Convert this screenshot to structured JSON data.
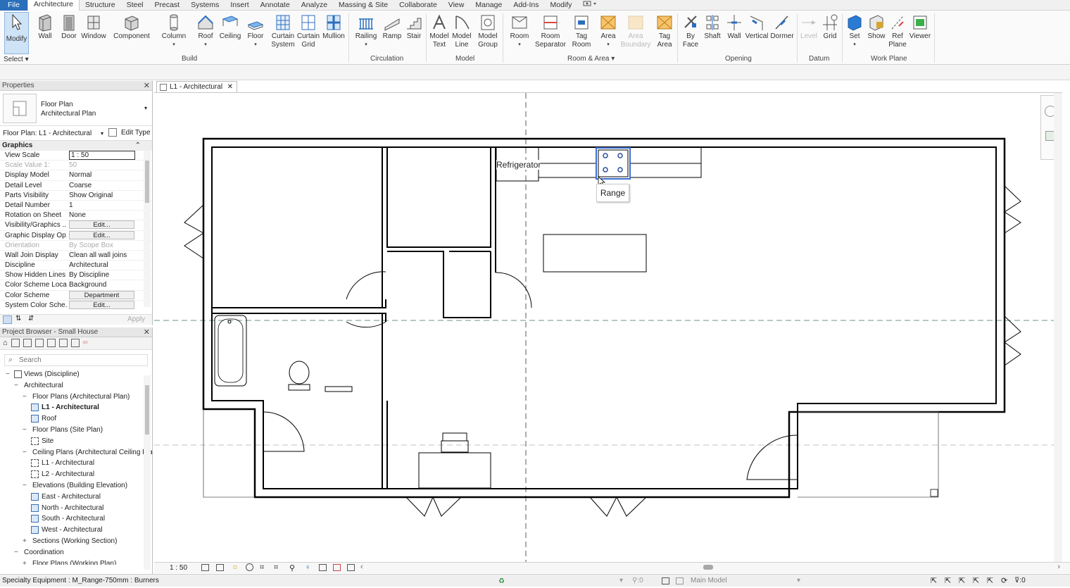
{
  "menu": {
    "file": "File",
    "tabs": [
      "Architecture",
      "Structure",
      "Steel",
      "Precast",
      "Systems",
      "Insert",
      "Annotate",
      "Analyze",
      "Massing & Site",
      "Collaborate",
      "View",
      "Manage",
      "Add-Ins",
      "Modify"
    ],
    "active": "Architecture"
  },
  "ribbon": {
    "modify": "Modify",
    "select": "Select",
    "groups": {
      "build": "Build",
      "circulation": "Circulation",
      "model": "Model",
      "room_area": "Room & Area",
      "opening": "Opening",
      "datum": "Datum",
      "work_plane": "Work Plane"
    },
    "tools": {
      "wall": "Wall",
      "door": "Door",
      "window": "Window",
      "component": "Component",
      "column": "Column",
      "roof": "Roof",
      "ceiling": "Ceiling",
      "floor": "Floor",
      "curtain_system_1": "Curtain",
      "curtain_system_2": "System",
      "curtain_grid_1": "Curtain",
      "curtain_grid_2": "Grid",
      "mullion": "Mullion",
      "railing": "Railing",
      "ramp": "Ramp",
      "stair": "Stair",
      "model_text_1": "Model",
      "model_text_2": "Text",
      "model_line_1": "Model",
      "model_line_2": "Line",
      "model_group_1": "Model",
      "model_group_2": "Group",
      "room": "Room",
      "room_sep_1": "Room",
      "room_sep_2": "Separator",
      "tag_room_1": "Tag",
      "tag_room_2": "Room",
      "area": "Area",
      "area_boundary_1": "Area",
      "area_boundary_2": "Boundary",
      "tag_area_1": "Tag",
      "tag_area_2": "Area",
      "by_face_1": "By",
      "by_face_2": "Face",
      "shaft": "Shaft",
      "wall_open": "Wall",
      "vertical": "Vertical",
      "dormer": "Dormer",
      "level": "Level",
      "grid": "Grid",
      "set": "Set",
      "show": "Show",
      "ref_plane_1": "Ref",
      "ref_plane_2": "Plane",
      "viewer": "Viewer"
    }
  },
  "properties": {
    "title": "Properties",
    "type_line1": "Floor Plan",
    "type_line2": "Architectural Plan",
    "instance": "Floor Plan: L1 - Architectural",
    "edit_type": "Edit Type",
    "section": "Graphics",
    "rows": [
      {
        "k": "View Scale",
        "v": "1 : 50"
      },
      {
        "k": "Scale Value    1:",
        "v": "50"
      },
      {
        "k": "Display Model",
        "v": "Normal"
      },
      {
        "k": "Detail Level",
        "v": "Coarse"
      },
      {
        "k": "Parts Visibility",
        "v": "Show Original"
      },
      {
        "k": "Detail Number",
        "v": "1"
      },
      {
        "k": "Rotation on Sheet",
        "v": "None"
      },
      {
        "k": "Visibility/Graphics ...",
        "v": "Edit..."
      },
      {
        "k": "Graphic Display Op...",
        "v": "Edit..."
      },
      {
        "k": "Orientation",
        "v": "By Scope Box"
      },
      {
        "k": "Wall Join Display",
        "v": "Clean all wall joins"
      },
      {
        "k": "Discipline",
        "v": "Architectural"
      },
      {
        "k": "Show Hidden Lines",
        "v": "By Discipline"
      },
      {
        "k": "Color Scheme Loca...",
        "v": "Background"
      },
      {
        "k": "Color Scheme",
        "v": "Department"
      },
      {
        "k": "System Color Sche...",
        "v": "Edit..."
      }
    ],
    "apply": "Apply"
  },
  "browser": {
    "title": "Project Browser - Small House",
    "search_placeholder": "Search",
    "items": [
      {
        "label": "Views (Discipline)",
        "depth": 0,
        "toggle": "−"
      },
      {
        "label": "Architectural",
        "depth": 1,
        "toggle": "−"
      },
      {
        "label": "Floor Plans (Architectural Plan)",
        "depth": 2,
        "toggle": "−"
      },
      {
        "label": "L1 - Architectural",
        "depth": 3,
        "bold": true
      },
      {
        "label": "Roof",
        "depth": 3
      },
      {
        "label": "Floor Plans (Site Plan)",
        "depth": 2,
        "toggle": "−"
      },
      {
        "label": "Site",
        "depth": 3,
        "plain": true
      },
      {
        "label": "Ceiling Plans (Architectural Ceiling Pla",
        "depth": 2,
        "toggle": "−"
      },
      {
        "label": "L1 - Architectural",
        "depth": 3,
        "plain": true
      },
      {
        "label": "L2 - Architectural",
        "depth": 3,
        "plain": true
      },
      {
        "label": "Elevations (Building Elevation)",
        "depth": 2,
        "toggle": "−"
      },
      {
        "label": "East - Architectural",
        "depth": 3
      },
      {
        "label": "North - Architectural",
        "depth": 3
      },
      {
        "label": "South - Architectural",
        "depth": 3
      },
      {
        "label": "West - Architectural",
        "depth": 3
      },
      {
        "label": "Sections (Working Section)",
        "depth": 2,
        "toggle": "+"
      },
      {
        "label": "Coordination",
        "depth": 1,
        "toggle": "−"
      },
      {
        "label": "Floor Plans (Working Plan)",
        "depth": 2,
        "toggle": "+"
      }
    ]
  },
  "view_tab": {
    "label": "L1 - Architectural"
  },
  "plan": {
    "refrigerator": "Refrigerator",
    "range": "Range"
  },
  "view_bar": {
    "scale": "1 : 50"
  },
  "status": {
    "text": "Specialty Equipment : M_Range-750mm : Burners",
    "model": "Main Model",
    "zero1": ":0",
    "zero2": ":0"
  }
}
